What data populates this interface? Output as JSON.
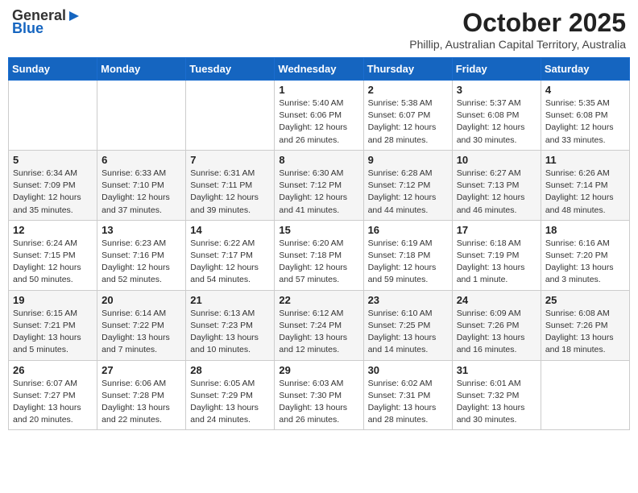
{
  "header": {
    "logo_general": "General",
    "logo_blue": "Blue",
    "title": "October 2025",
    "subtitle": "Phillip, Australian Capital Territory, Australia"
  },
  "days_of_week": [
    "Sunday",
    "Monday",
    "Tuesday",
    "Wednesday",
    "Thursday",
    "Friday",
    "Saturday"
  ],
  "weeks": [
    [
      {
        "day": "",
        "info": ""
      },
      {
        "day": "",
        "info": ""
      },
      {
        "day": "",
        "info": ""
      },
      {
        "day": "1",
        "info": "Sunrise: 5:40 AM\nSunset: 6:06 PM\nDaylight: 12 hours\nand 26 minutes."
      },
      {
        "day": "2",
        "info": "Sunrise: 5:38 AM\nSunset: 6:07 PM\nDaylight: 12 hours\nand 28 minutes."
      },
      {
        "day": "3",
        "info": "Sunrise: 5:37 AM\nSunset: 6:08 PM\nDaylight: 12 hours\nand 30 minutes."
      },
      {
        "day": "4",
        "info": "Sunrise: 5:35 AM\nSunset: 6:08 PM\nDaylight: 12 hours\nand 33 minutes."
      }
    ],
    [
      {
        "day": "5",
        "info": "Sunrise: 6:34 AM\nSunset: 7:09 PM\nDaylight: 12 hours\nand 35 minutes."
      },
      {
        "day": "6",
        "info": "Sunrise: 6:33 AM\nSunset: 7:10 PM\nDaylight: 12 hours\nand 37 minutes."
      },
      {
        "day": "7",
        "info": "Sunrise: 6:31 AM\nSunset: 7:11 PM\nDaylight: 12 hours\nand 39 minutes."
      },
      {
        "day": "8",
        "info": "Sunrise: 6:30 AM\nSunset: 7:12 PM\nDaylight: 12 hours\nand 41 minutes."
      },
      {
        "day": "9",
        "info": "Sunrise: 6:28 AM\nSunset: 7:12 PM\nDaylight: 12 hours\nand 44 minutes."
      },
      {
        "day": "10",
        "info": "Sunrise: 6:27 AM\nSunset: 7:13 PM\nDaylight: 12 hours\nand 46 minutes."
      },
      {
        "day": "11",
        "info": "Sunrise: 6:26 AM\nSunset: 7:14 PM\nDaylight: 12 hours\nand 48 minutes."
      }
    ],
    [
      {
        "day": "12",
        "info": "Sunrise: 6:24 AM\nSunset: 7:15 PM\nDaylight: 12 hours\nand 50 minutes."
      },
      {
        "day": "13",
        "info": "Sunrise: 6:23 AM\nSunset: 7:16 PM\nDaylight: 12 hours\nand 52 minutes."
      },
      {
        "day": "14",
        "info": "Sunrise: 6:22 AM\nSunset: 7:17 PM\nDaylight: 12 hours\nand 54 minutes."
      },
      {
        "day": "15",
        "info": "Sunrise: 6:20 AM\nSunset: 7:18 PM\nDaylight: 12 hours\nand 57 minutes."
      },
      {
        "day": "16",
        "info": "Sunrise: 6:19 AM\nSunset: 7:18 PM\nDaylight: 12 hours\nand 59 minutes."
      },
      {
        "day": "17",
        "info": "Sunrise: 6:18 AM\nSunset: 7:19 PM\nDaylight: 13 hours\nand 1 minute."
      },
      {
        "day": "18",
        "info": "Sunrise: 6:16 AM\nSunset: 7:20 PM\nDaylight: 13 hours\nand 3 minutes."
      }
    ],
    [
      {
        "day": "19",
        "info": "Sunrise: 6:15 AM\nSunset: 7:21 PM\nDaylight: 13 hours\nand 5 minutes."
      },
      {
        "day": "20",
        "info": "Sunrise: 6:14 AM\nSunset: 7:22 PM\nDaylight: 13 hours\nand 7 minutes."
      },
      {
        "day": "21",
        "info": "Sunrise: 6:13 AM\nSunset: 7:23 PM\nDaylight: 13 hours\nand 10 minutes."
      },
      {
        "day": "22",
        "info": "Sunrise: 6:12 AM\nSunset: 7:24 PM\nDaylight: 13 hours\nand 12 minutes."
      },
      {
        "day": "23",
        "info": "Sunrise: 6:10 AM\nSunset: 7:25 PM\nDaylight: 13 hours\nand 14 minutes."
      },
      {
        "day": "24",
        "info": "Sunrise: 6:09 AM\nSunset: 7:26 PM\nDaylight: 13 hours\nand 16 minutes."
      },
      {
        "day": "25",
        "info": "Sunrise: 6:08 AM\nSunset: 7:26 PM\nDaylight: 13 hours\nand 18 minutes."
      }
    ],
    [
      {
        "day": "26",
        "info": "Sunrise: 6:07 AM\nSunset: 7:27 PM\nDaylight: 13 hours\nand 20 minutes."
      },
      {
        "day": "27",
        "info": "Sunrise: 6:06 AM\nSunset: 7:28 PM\nDaylight: 13 hours\nand 22 minutes."
      },
      {
        "day": "28",
        "info": "Sunrise: 6:05 AM\nSunset: 7:29 PM\nDaylight: 13 hours\nand 24 minutes."
      },
      {
        "day": "29",
        "info": "Sunrise: 6:03 AM\nSunset: 7:30 PM\nDaylight: 13 hours\nand 26 minutes."
      },
      {
        "day": "30",
        "info": "Sunrise: 6:02 AM\nSunset: 7:31 PM\nDaylight: 13 hours\nand 28 minutes."
      },
      {
        "day": "31",
        "info": "Sunrise: 6:01 AM\nSunset: 7:32 PM\nDaylight: 13 hours\nand 30 minutes."
      },
      {
        "day": "",
        "info": ""
      }
    ]
  ]
}
